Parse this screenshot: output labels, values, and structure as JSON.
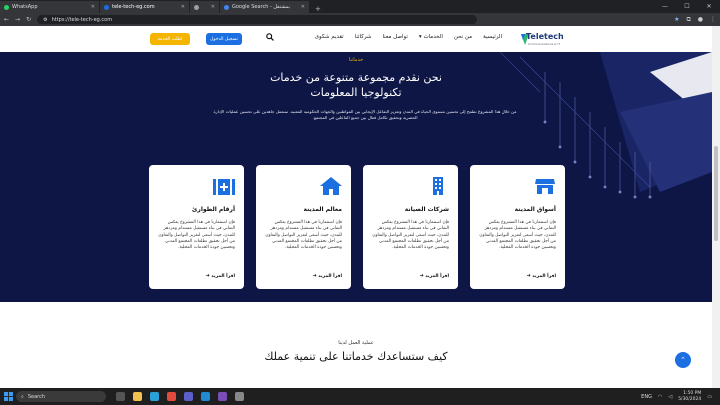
{
  "browser": {
    "tabs": [
      {
        "title": "WhatsApp",
        "color": "#25d366"
      },
      {
        "title": "tele-tech-eg.com",
        "color": "#1c6fe0"
      },
      {
        "title": "",
        "color": "#9aa0a6"
      },
      {
        "title": "Google Search - بمشتقل",
        "color": "#4285f4"
      }
    ],
    "url": "https://tele-tech-eg.com"
  },
  "nav": {
    "cta_yellow": "اطلب الخدمة",
    "cta_blue": "تسجيل الدخول",
    "links": [
      "الرئيسية",
      "من نحن",
      "الخدمات",
      "تواصل معنا",
      "شركائنا",
      "تقديم شكوى"
    ],
    "logo_text": "Teletech",
    "logo_sub": "Communications & IT"
  },
  "hero": {
    "eyebrow": "خدماتنا",
    "title_line1": "نحن نقدم مجموعة متنوعة من خدمات",
    "title_line2": "تكنولوجيا المعلومات",
    "subtitle": "من خلال هذا المشروع نطمح إلى تحسين مستوى الحياة في المدن وتعزيز التفاعل الإيجابي بين المواطنين والجهات الحكومية المعنية. سنعمل جاهدين على تحسين عمليات الإدارة الحضرية وتحقيق تكامل فعال بين جميع الفاعلين في المجتمع."
  },
  "cards": [
    {
      "title": "أسواق المدينة",
      "icon": "store-icon",
      "body": "فإن استثمارنا في هذا المشروع يعكس التفاني في بناء مستقبل مستدام ومزدهر للمدن، حيث أسعى لتعزيز التواصل والتعاون من أجل تحقيق تطلعات المجتمع المدني وتحسين جودة الخدمات المحلية.",
      "link": "اقرأ المزيد"
    },
    {
      "title": "شركات الصيانة",
      "icon": "building-icon",
      "body": "فإن استثمارنا في هذا المشروع يعكس التفاني في بناء مستقبل مستدام ومزدهر للمدن، حيث أسعى لتعزيز التواصل والتعاون من أجل تحقيق تطلعات المجتمع المدني وتحسين جودة الخدمات المحلية.",
      "link": "اقرأ المزيد"
    },
    {
      "title": "معالم المدينة",
      "icon": "home-icon",
      "body": "فإن استثمارنا في هذا المشروع يعكس التفاني في بناء مستقبل مستدام ومزدهر للمدن، حيث أسعى لتعزيز التواصل والتعاون من أجل تحقيق تطلعات المجتمع المدني وتحسين جودة الخدمات المحلية.",
      "link": "اقرأ المزيد"
    },
    {
      "title": "أرقام الطوارئ",
      "icon": "first-aid-icon",
      "body": "فإن استثمارنا في هذا المشروع يعكس التفاني في بناء مستقبل مستدام ومزدهر للمدن، حيث أسعى لتعزيز التواصل والتعاون من أجل تحقيق تطلعات المجتمع المدني وتحسين جودة الخدمات المحلية.",
      "link": "اقرأ المزيد"
    }
  ],
  "section2": {
    "eyebrow": "عملية العمل لدينا",
    "title": "كيف ستساعدك خدماتنا على تنمية عملك"
  },
  "taskbar": {
    "search": "Search",
    "time": "1:50 PM",
    "date": "5/30/2024",
    "lang": "ENG"
  },
  "colors": {
    "navy": "#0e1646",
    "accent_blue": "#1c6fe0",
    "accent_yellow": "#f4b400"
  }
}
